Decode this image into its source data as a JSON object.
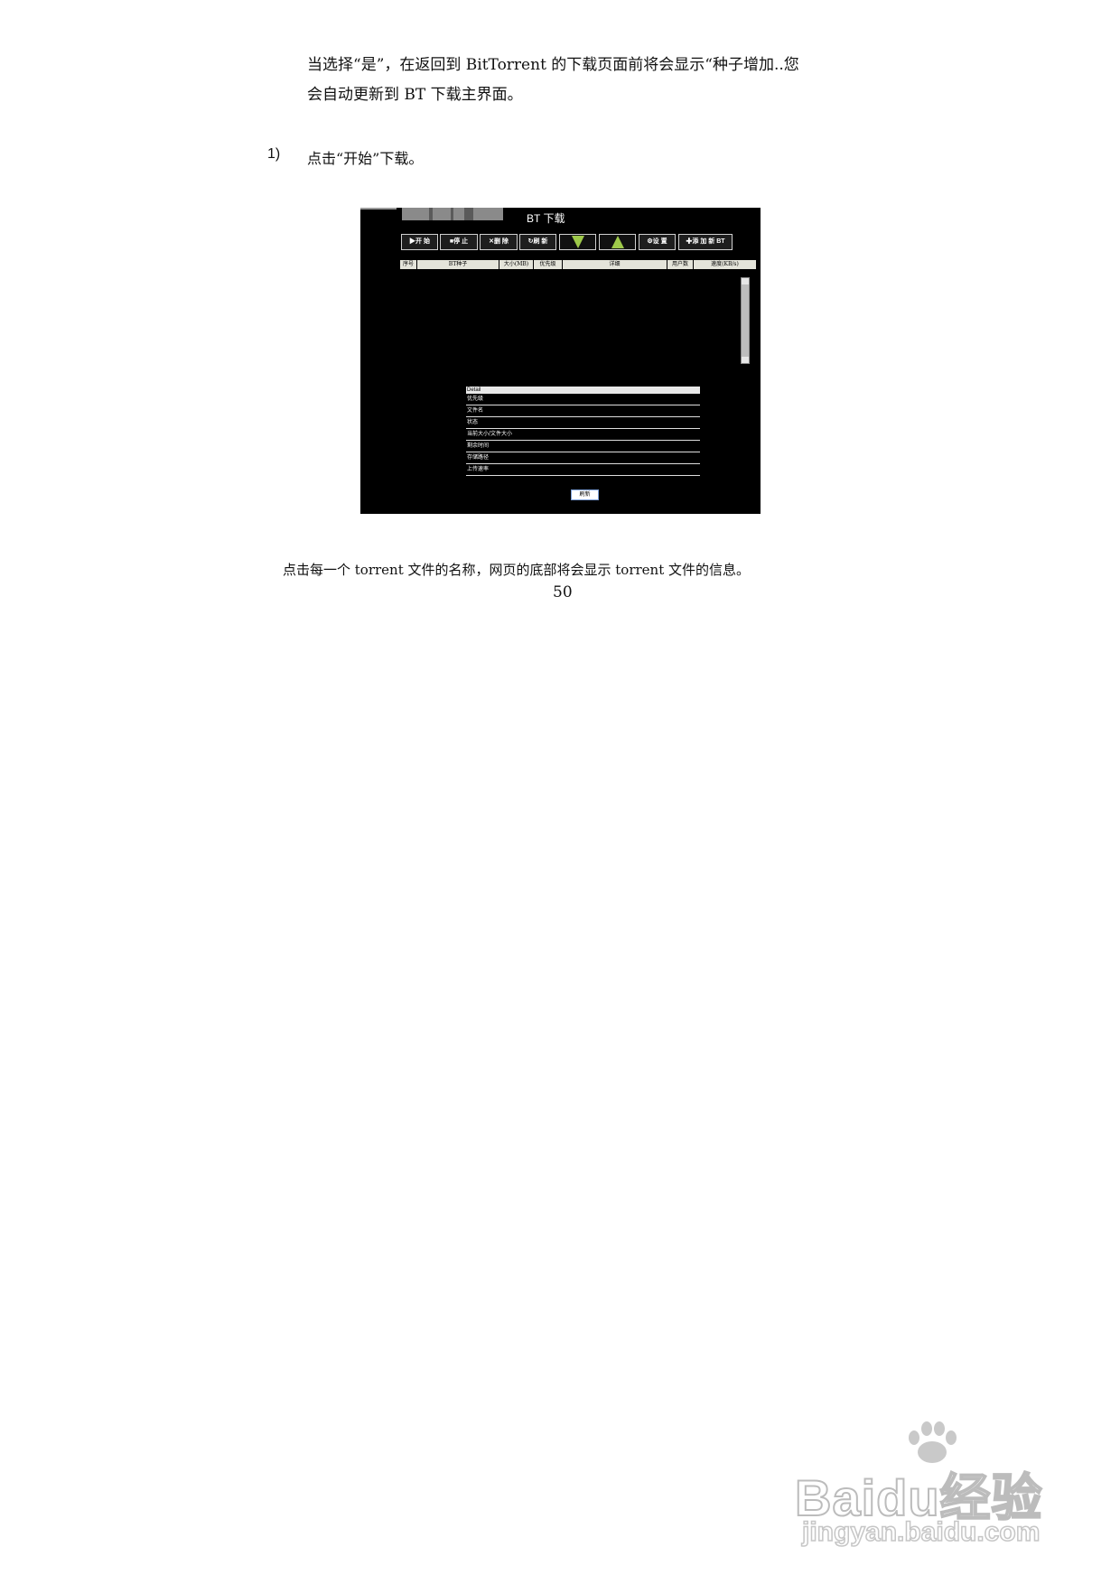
{
  "intro_paragraph": {
    "line1": "当选择“是”，在返回到 BitTorrent 的下载页面前将会显示“种子增加..您",
    "line2": "会自动更新到 BT 下载主界面。"
  },
  "step": {
    "number": "1)",
    "text": "点击“开始”下载。"
  },
  "screenshot": {
    "title": "BT 下载",
    "toolbar": {
      "start": "▶开 始",
      "stop": "■停 止",
      "delete": "✕删 除",
      "refresh": "↻刷 新",
      "down_icon": "arrow-down-icon",
      "up_icon": "arrow-up-icon",
      "settings": "⚙设 置",
      "add": "✚添 加 新 BT"
    },
    "table_headers": [
      "序号",
      "BT种子",
      "大小(MB)",
      "优先级",
      "详细",
      "用户数",
      "速度(KB/s)"
    ],
    "detail": {
      "header": "Detail",
      "rows": [
        "优先级",
        "文件名",
        "状态",
        "当前大小/文件大小",
        "剩余时间",
        "存储路径",
        "上传速率"
      ],
      "button": "刷新"
    },
    "colors": {
      "background": "#000000",
      "arrow": "#9ec94a"
    }
  },
  "caption": "点击每一个 torrent 文件的名称，网页的底部将会显示 torrent 文件的信息。",
  "page_number": "50",
  "watermark": {
    "brand": "Baidu经验",
    "site": "jingyan.baidu.com"
  }
}
